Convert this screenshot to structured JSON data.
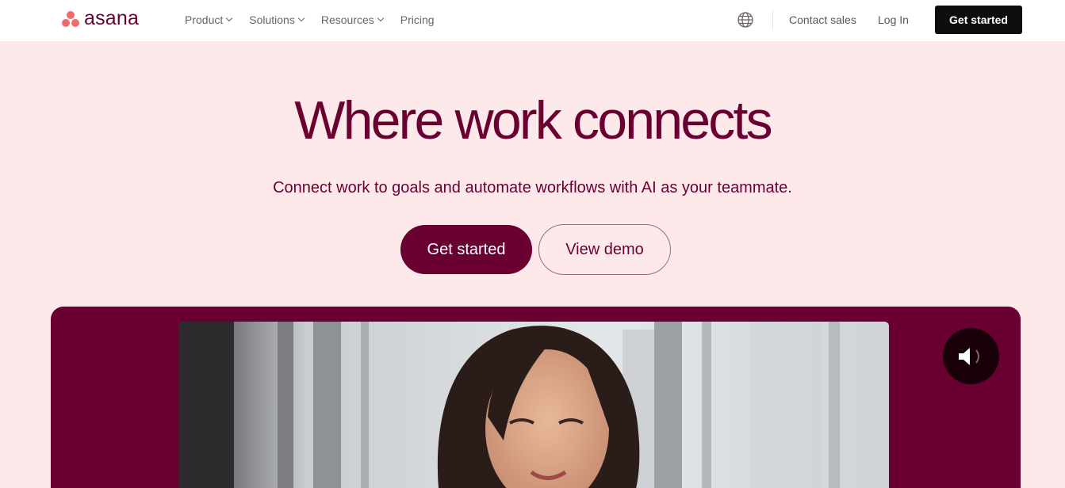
{
  "header": {
    "logo_text": "asana",
    "nav": [
      {
        "label": "Product",
        "has_dropdown": true
      },
      {
        "label": "Solutions",
        "has_dropdown": true
      },
      {
        "label": "Resources",
        "has_dropdown": true
      },
      {
        "label": "Pricing",
        "has_dropdown": false
      }
    ],
    "globe_icon": "globe-icon",
    "contact_sales": "Contact sales",
    "log_in": "Log In",
    "get_started": "Get started"
  },
  "hero": {
    "headline": "Where work connects",
    "subheadline": "Connect work to goals and automate workflows with AI as your teammate.",
    "primary_cta": "Get started",
    "secondary_cta": "View demo"
  },
  "media": {
    "sound_icon": "speaker-volume-icon"
  },
  "colors": {
    "brand": "#690031",
    "background": "#fde8ea",
    "logo_coral": "#f06a6a",
    "header_button": "#0e0e0e"
  }
}
